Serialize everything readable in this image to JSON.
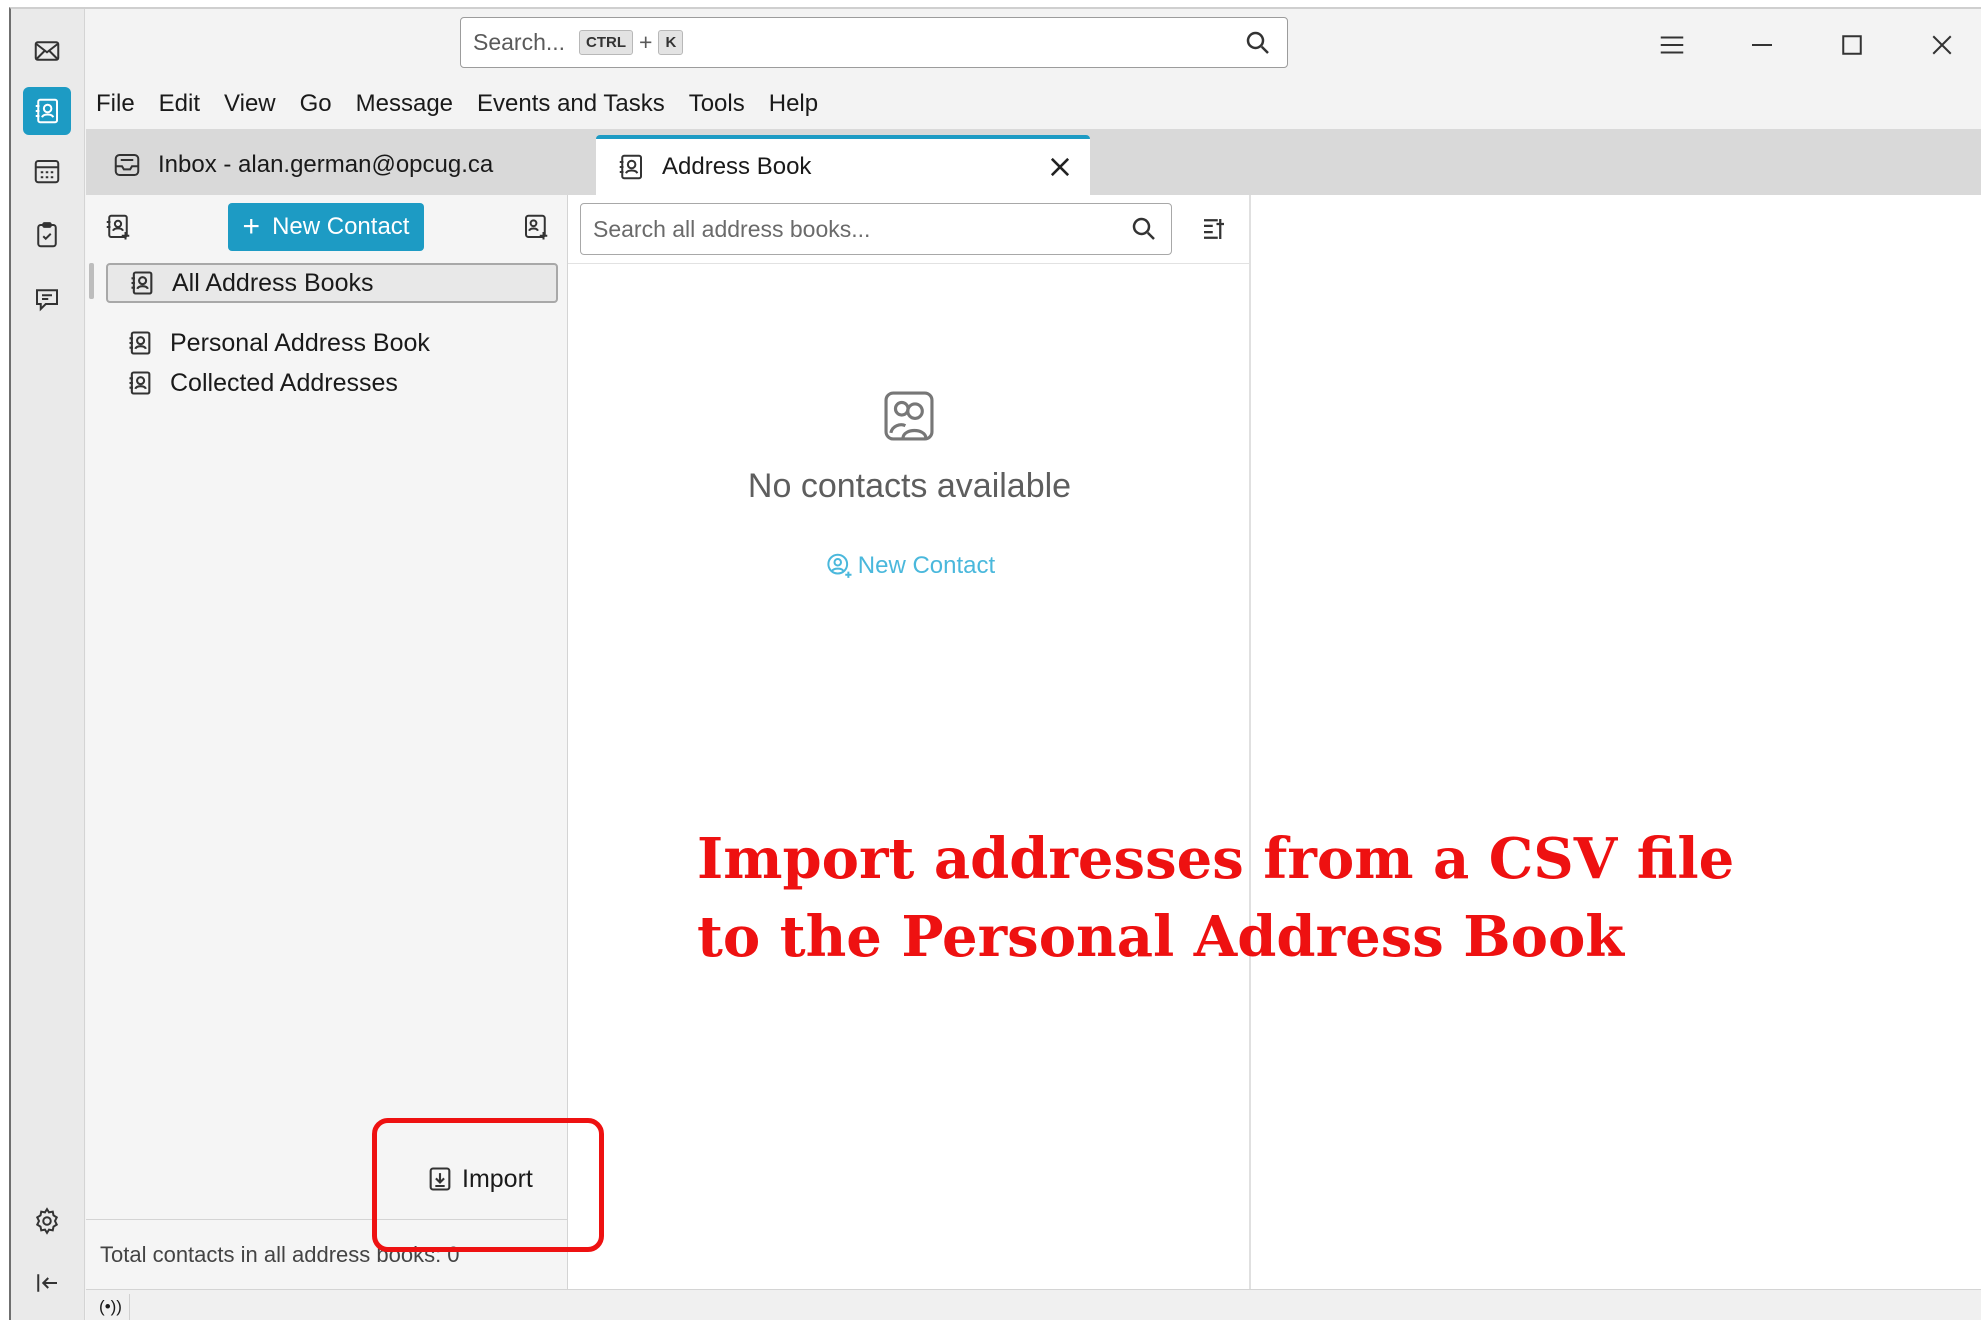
{
  "titlebar": {
    "search_placeholder": "Search...",
    "shortcut_key1": "CTRL",
    "shortcut_plus": "+",
    "shortcut_key2": "K"
  },
  "menu": [
    "File",
    "Edit",
    "View",
    "Go",
    "Message",
    "Events and Tasks",
    "Tools",
    "Help"
  ],
  "tabs": [
    {
      "label": "Inbox - alan.german@opcug.ca",
      "icon": "inbox-icon"
    },
    {
      "label": "Address Book",
      "icon": "address-book-icon"
    }
  ],
  "books_pane": {
    "new_contact_label": "New Contact",
    "items": [
      {
        "label": "All Address Books",
        "selected": true
      },
      {
        "label": "Personal Address Book",
        "selected": false
      },
      {
        "label": "Collected Addresses",
        "selected": false
      }
    ],
    "import_label": "Import",
    "footer": "Total contacts in all address books: 0"
  },
  "cards_pane": {
    "search_placeholder": "Search all address books...",
    "empty_text": "No contacts available",
    "empty_new_contact": "New Contact"
  },
  "status": {
    "icon": "(•))"
  },
  "annotation": {
    "line1": "Import addresses from a CSV file",
    "line2": "to the Personal Address Book"
  },
  "colors": {
    "accent": "#1d9bc4",
    "annotation": "#ee1111"
  }
}
